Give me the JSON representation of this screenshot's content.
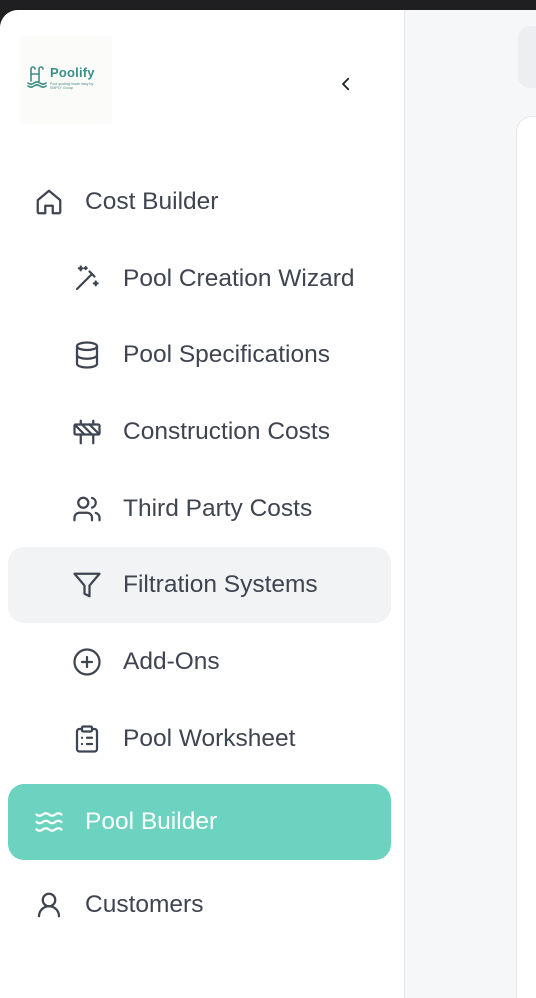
{
  "brand": {
    "name": "Poolify",
    "tagline": "Pool quoting made easy by SMPLY Group",
    "accent": "#6bd3c0"
  },
  "sidebar": {
    "collapse_icon": "chevron-left-icon",
    "items": [
      {
        "label": "Cost Builder",
        "icon": "home-icon",
        "level": "top",
        "state": "normal"
      },
      {
        "label": "Pool Creation Wizard",
        "icon": "magic-wand-icon",
        "level": "sub",
        "state": "normal"
      },
      {
        "label": "Pool Specifications",
        "icon": "database-icon",
        "level": "sub",
        "state": "normal"
      },
      {
        "label": "Construction Costs",
        "icon": "construction-barrier-icon",
        "level": "sub",
        "state": "normal"
      },
      {
        "label": "Third Party Costs",
        "icon": "users-icon",
        "level": "sub",
        "state": "normal"
      },
      {
        "label": "Filtration Systems",
        "icon": "filter-icon",
        "level": "sub",
        "state": "hover"
      },
      {
        "label": "Add-Ons",
        "icon": "plus-circle-icon",
        "level": "sub",
        "state": "normal"
      },
      {
        "label": "Pool Worksheet",
        "icon": "clipboard-list-icon",
        "level": "sub",
        "state": "normal"
      },
      {
        "label": "Pool Builder",
        "icon": "waves-icon",
        "level": "top",
        "state": "active"
      },
      {
        "label": "Customers",
        "icon": "user-icon",
        "level": "top",
        "state": "normal"
      }
    ]
  }
}
